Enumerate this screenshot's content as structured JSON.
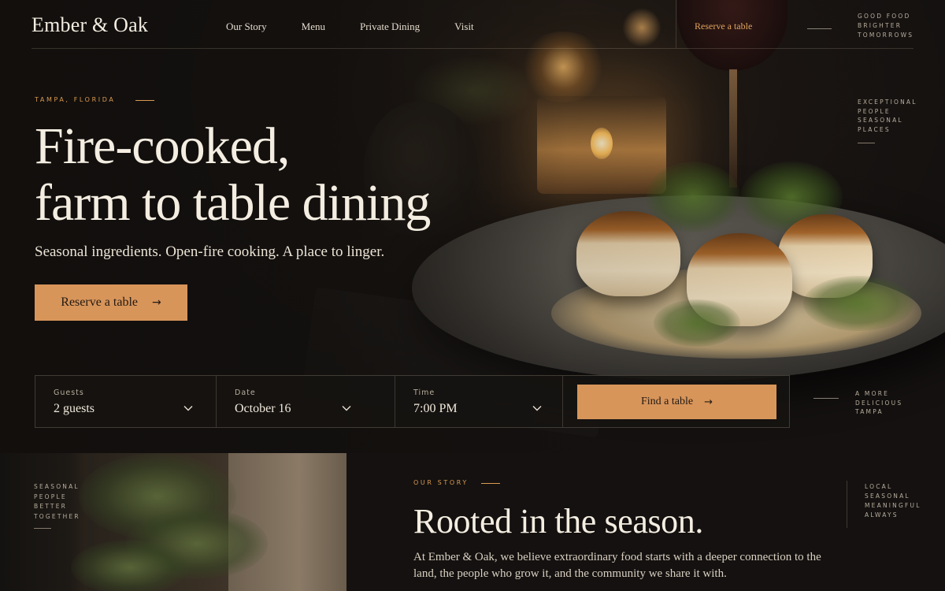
{
  "nav": {
    "brand": "Ember & Oak",
    "links": [
      "Our Story",
      "Menu",
      "Private Dining",
      "Visit"
    ],
    "reserve": "Reserve a table",
    "tagline": [
      "GOOD FOOD",
      "BRIGHTER",
      "TOMORROWS"
    ]
  },
  "hero": {
    "eyebrow": "TAMPA, FLORIDA",
    "title_line1": "Fire-cooked,",
    "title_line2": "farm to table dining",
    "subtitle": "Seasonal ingredients. Open-fire cooking. A place to linger.",
    "cta": "Reserve a table",
    "cta_icon": "arrow-right-icon",
    "side_words": [
      "EXCEPTIONAL",
      "PEOPLE",
      "SEASONAL",
      "PLACES"
    ]
  },
  "booking": {
    "guests": {
      "label": "Guests",
      "value": "2 guests"
    },
    "date": {
      "label": "Date",
      "value": "October 16"
    },
    "time": {
      "label": "Time",
      "value": "7:00 PM"
    },
    "find": "Find a table",
    "find_icon": "arrow-right-icon",
    "side_words": [
      "A MORE",
      "DELICIOUS",
      "TAMPA"
    ]
  },
  "story": {
    "image_words": [
      "SEASONAL",
      "PEOPLE",
      "BETTER",
      "TOGETHER"
    ],
    "eyebrow": "OUR STORY",
    "title": "Rooted in the season.",
    "body": "At Ember & Oak, we believe extraordinary food starts with a deeper connection to the land, the people who grow it, and the community we share it with.",
    "side_words": [
      "LOCAL",
      "SEASONAL",
      "MEANINGFUL",
      "ALWAYS"
    ]
  },
  "colors": {
    "background": "#141110",
    "accent": "#d8955a",
    "accent_text": "#e0a45e",
    "text": "#f4ede1"
  }
}
